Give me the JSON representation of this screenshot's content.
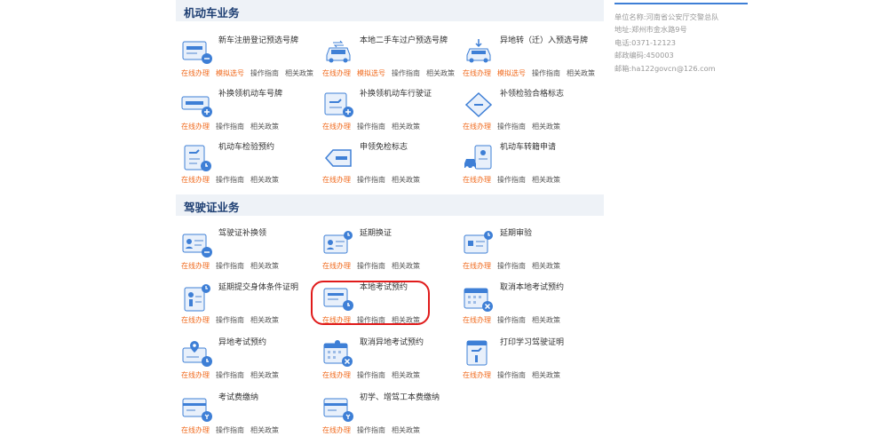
{
  "sections": {
    "vehicle": "机动车业务",
    "license": "驾驶证业务"
  },
  "links": {
    "online": "在线办理",
    "mock": "模拟选号",
    "guide": "操作指南",
    "policy": "相关政策"
  },
  "vehicle_items": [
    {
      "title": "新车注册登记预选号牌",
      "icon": "car-plate-icon",
      "mock": true
    },
    {
      "title": "本地二手车过户预选号牌",
      "icon": "car-transfer-icon",
      "mock": true
    },
    {
      "title": "异地转（迁）入预选号牌",
      "icon": "car-arrival-icon",
      "mock": true
    },
    {
      "title": "补换领机动车号牌",
      "icon": "plate-replace-icon"
    },
    {
      "title": "补换领机动车行驶证",
      "icon": "license-replace-icon"
    },
    {
      "title": "补领检验合格标志",
      "icon": "inspection-mark-icon"
    },
    {
      "title": "机动车检验预约",
      "icon": "inspection-appointment-icon"
    },
    {
      "title": "申领免检标志",
      "icon": "exempt-mark-icon"
    },
    {
      "title": "机动车转籍申请",
      "icon": "vehicle-transfer-icon"
    }
  ],
  "license_items": [
    {
      "title": "驾驶证补换领",
      "icon": "license-card-icon"
    },
    {
      "title": "延期换证",
      "icon": "license-extend-icon"
    },
    {
      "title": "延期审验",
      "icon": "review-extend-icon"
    },
    {
      "title": "延期提交身体条件证明",
      "icon": "health-cert-icon"
    },
    {
      "title": "本地考试预约",
      "icon": "exam-appointment-icon"
    },
    {
      "title": "取消本地考试预约",
      "icon": "cancel-exam-icon"
    },
    {
      "title": "异地考试预约",
      "icon": "remote-exam-icon"
    },
    {
      "title": "取消异地考试预约",
      "icon": "cancel-remote-exam-icon"
    },
    {
      "title": "打印学习驾驶证明",
      "icon": "print-study-cert-icon"
    },
    {
      "title": "考试费缴纳",
      "icon": "exam-fee-icon"
    },
    {
      "title": "初学、增驾工本费缴纳",
      "icon": "learner-fee-icon"
    }
  ],
  "contact": {
    "unit": "单位名称:河南省公安厅交警总队",
    "address": "地址:郑州市金水路9号",
    "phone": "电话:0371-12123",
    "postcode": "邮政编码:450003",
    "email": "邮箱:ha122govcn@126.com"
  },
  "colors": {
    "accent": "#3e7fd6",
    "online": "#f06a1d",
    "section_bg": "#eef2f7",
    "highlight": "#e01b1b"
  }
}
